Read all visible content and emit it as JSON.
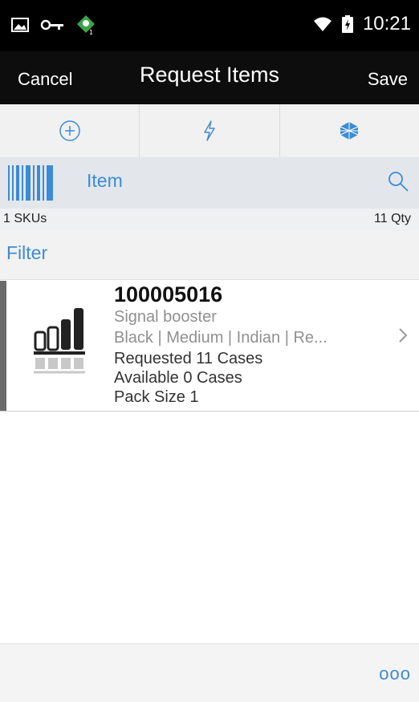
{
  "status_bar": {
    "time": "10:21",
    "icons": [
      "gallery-icon",
      "key-icon",
      "android-notification-icon",
      "wifi-icon",
      "battery-icon"
    ]
  },
  "header": {
    "cancel_label": "Cancel",
    "title": "Request Items",
    "save_label": "Save"
  },
  "toolbar": {
    "buttons": [
      {
        "icon": "add-circle-icon"
      },
      {
        "icon": "lightning-icon"
      },
      {
        "icon": "cube-grid-icon"
      }
    ]
  },
  "search": {
    "placeholder": "Item",
    "barcode_icon": "barcode-icon",
    "search_icon": "search-icon"
  },
  "summary": {
    "skus": "1 SKUs",
    "qty": "11 Qty"
  },
  "filter": {
    "label": "Filter"
  },
  "items": [
    {
      "id": "100005016",
      "description": "Signal booster",
      "attributes": "Black | Medium | Indian | Re...",
      "requested": "Requested 11 Cases",
      "available": "Available 0 Cases",
      "pack_size": "Pack Size 1",
      "image_icon": "signal-booster-icon"
    }
  ],
  "footer": {
    "more_label": "ooo"
  },
  "colors": {
    "accent": "#3d8bd6",
    "header_bg": "#0d0d0d",
    "toolbar_bg": "#f1f1f1",
    "search_bg": "#e3e7eb"
  }
}
